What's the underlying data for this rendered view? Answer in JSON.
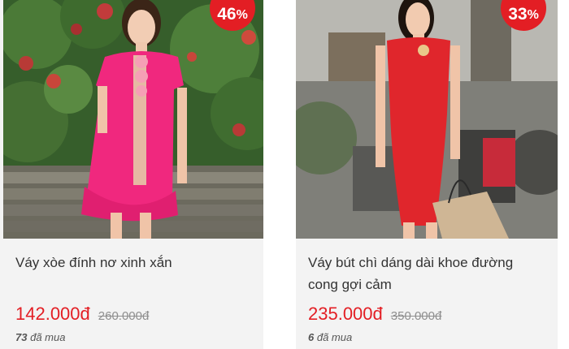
{
  "products": [
    {
      "discount": "46",
      "discount_symbol": "%",
      "title": "Váy xòe đính nơ xinh xắn",
      "price": "142.000đ",
      "old_price": "260.000đ",
      "sold_count": "73",
      "sold_label": "đã mua",
      "colors": {
        "dress": "#f0287e",
        "background": "#2f5a25"
      }
    },
    {
      "discount": "33",
      "discount_symbol": "%",
      "title": "Váy bút chì dáng dài khoe đường cong gợi cảm",
      "price": "235.000đ",
      "old_price": "350.000đ",
      "sold_count": "6",
      "sold_label": "đã mua",
      "colors": {
        "dress": "#e0262c",
        "background": "#8a8a84"
      }
    }
  ],
  "accent_color": "#e31e24"
}
